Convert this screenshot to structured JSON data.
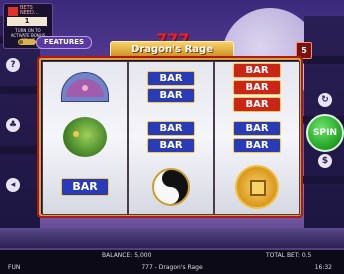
{
  "game": {
    "title": "777 - Dragon's Rage",
    "logo_prefix": "777",
    "logo_name": "Dragon's Rage"
  },
  "top_widget": {
    "header": "BETS\nNEED...",
    "count": "1",
    "caption": "TURN ON TO ACTIVATE BONUS STRIKE"
  },
  "features_button": {
    "label": "FEATURES"
  },
  "lines_badge": {
    "value": "5"
  },
  "reels": [
    {
      "symbols": [
        "fan",
        "dragon",
        "BAR"
      ]
    },
    {
      "symbols": [
        "BAR BAR",
        "BAR BAR",
        "yin-yang"
      ]
    },
    {
      "symbols": [
        "BAR BAR BAR",
        "BAR BAR",
        "coin"
      ]
    }
  ],
  "bar_label": "BAR",
  "spin_button": {
    "label": "SPIN"
  },
  "status": {
    "balance_label": "BALANCE:",
    "balance_value": "5,000",
    "total_bet_label": "TOTAL BET:",
    "total_bet_value": "0.5",
    "mode": "FUN",
    "time": "16:32"
  },
  "side_buttons": {
    "help_icon": "question-icon",
    "paytable_icon": "tree-icon",
    "sound_icon": "speaker-icon",
    "autoplay_icon": "refresh-icon",
    "quick_icon": "dollar-icon"
  },
  "colors": {
    "frame_red": "#b11818",
    "gold": "#d7a13a",
    "bar_blue": "#2a3bb8",
    "bar_red": "#c92618",
    "spin_green": "#21a021"
  }
}
